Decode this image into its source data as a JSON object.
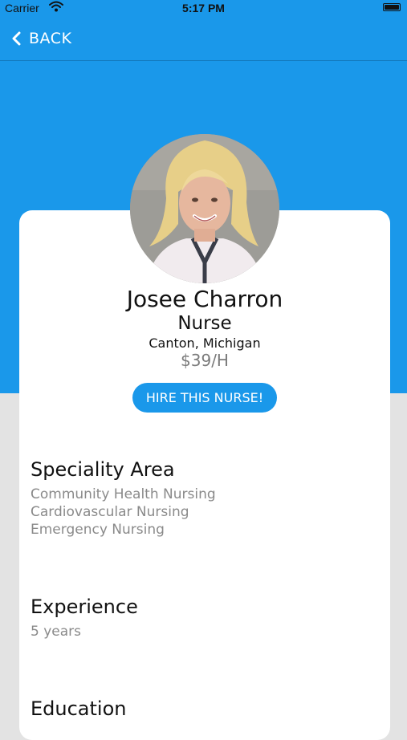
{
  "status_bar": {
    "carrier": "Carrier",
    "time": "5:17 PM"
  },
  "nav": {
    "back_label": "BACK"
  },
  "profile": {
    "name": "Josee Charron",
    "role": "Nurse",
    "location": "Canton, Michigan",
    "rate": "$39/H",
    "hire_label": "HIRE THIS NURSE!"
  },
  "speciality": {
    "title": "Speciality Area",
    "items": [
      "Community Health Nursing",
      "Cardiovascular Nursing",
      "Emergency Nursing"
    ]
  },
  "experience": {
    "title": "Experience",
    "value": "5 years"
  },
  "education": {
    "title": "Education"
  },
  "colors": {
    "primary_blue": "#1a98ea",
    "background_gray": "#e3e3e3",
    "card_white": "#ffffff",
    "muted_text": "#8a8a8a"
  }
}
